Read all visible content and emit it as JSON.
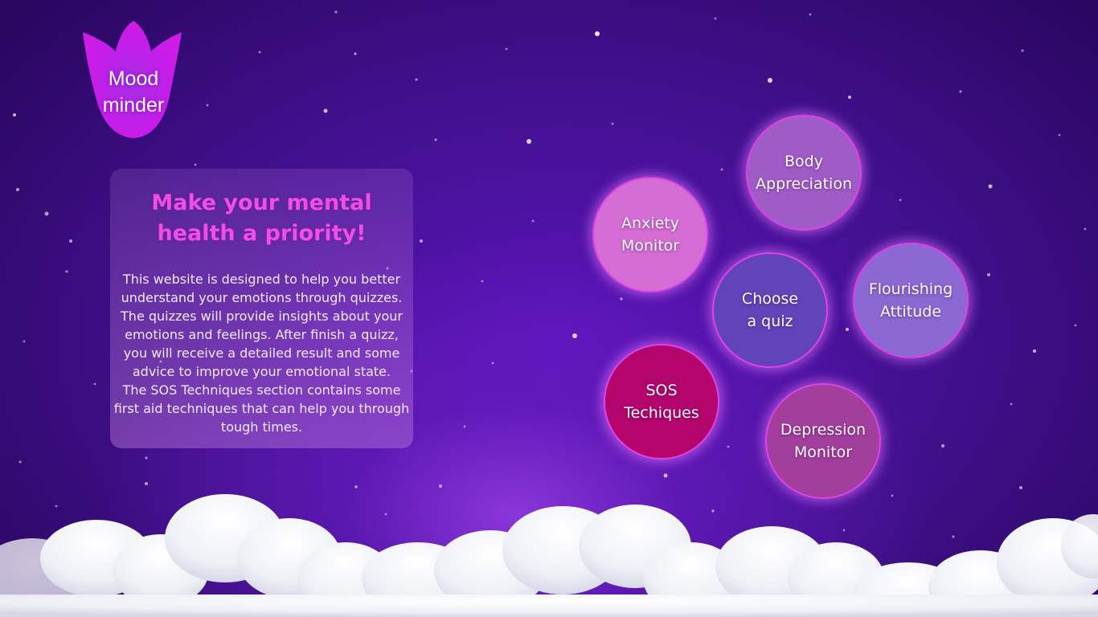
{
  "app": {
    "logo": {
      "line1": "Mood",
      "line2": "minder",
      "icon": "tulip-icon",
      "color": "#d21be6"
    }
  },
  "intro": {
    "title_lines": [
      "Make your mental",
      "health a priority!"
    ],
    "text_lines": [
      "This website is designed to help you better",
      "understand your emotions through quizzes.",
      "The quizzes will provide insights about your",
      "emotions and feelings. After finish a quizz,",
      "you will receive a detailed result and some",
      "advice to improve your emotional state.",
      "The SOS Techniques section contains some",
      "first aid techniques that can help you through",
      "tough times."
    ]
  },
  "quizzes": {
    "body": {
      "line1": "Body",
      "line2": "Appreciation",
      "color": "#a05cc6"
    },
    "anxiety": {
      "line1": "Anxiety",
      "line2": "Monitor",
      "color": "#d46ed4"
    },
    "choose": {
      "line1": "Choose",
      "line2": "a quiz",
      "color": "#6244ba"
    },
    "flourishing": {
      "line1": "Flourishing",
      "line2": "Attitude",
      "color": "#8c68d2"
    },
    "sos": {
      "line1": "SOS",
      "line2": "Techiques",
      "color": "#b3056b"
    },
    "depression": {
      "line1": "Depression",
      "line2": "Monitor",
      "color": "#a23e9c"
    }
  },
  "theme": {
    "background": "#40108c",
    "title_color": "#f24de6",
    "bubble_border": "#e040e8"
  }
}
